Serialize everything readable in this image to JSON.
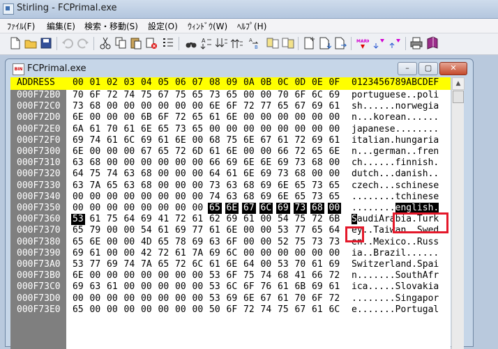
{
  "app": {
    "title": "Stirling - FCPrimal.exe"
  },
  "menu": [
    {
      "label": "ﾌｧｲﾙ(F)"
    },
    {
      "label": "編集(E)"
    },
    {
      "label": "検索・移動(S)"
    },
    {
      "label": "設定(O)"
    },
    {
      "label": "ｳｨﾝﾄﾞｳ(W)"
    },
    {
      "label": "ﾍﾙﾌﾟ(H)"
    }
  ],
  "toolbar": {
    "icons": [
      "new-file-icon",
      "open-folder-icon",
      "save-icon",
      "undo-icon",
      "redo-icon",
      "cut-icon",
      "copy-icon",
      "paste-icon",
      "delete-icon",
      "insert-icon",
      "find-icon",
      "find-next-icon",
      "find-prev-icon",
      "find-all-icon",
      "replace-icon",
      "compare-icon",
      "jump-icon",
      "page-icon",
      "page-down-icon",
      "page-icon-2",
      "mark-icon",
      "mark-next-icon",
      "mark-prev-icon",
      "print-icon",
      "book-icon"
    ]
  },
  "child": {
    "title": "FCPrimal.exe",
    "buttons": {
      "minimize": "–",
      "maximize": "▢",
      "close": "✕"
    }
  },
  "hex": {
    "header": {
      "address": "ADDRESS",
      "cols": [
        "00",
        "01",
        "02",
        "03",
        "04",
        "05",
        "06",
        "07",
        "08",
        "09",
        "0A",
        "0B",
        "0C",
        "0D",
        "0E",
        "0F"
      ],
      "ascii": "0123456789ABCDEF"
    },
    "rows": [
      {
        "addr": "000F72B0",
        "bytes": [
          "70",
          "6F",
          "72",
          "74",
          "75",
          "67",
          "75",
          "65",
          "73",
          "65",
          "00",
          "00",
          "70",
          "6F",
          "6C",
          "69"
        ],
        "ascii": "portuguese..poli"
      },
      {
        "addr": "000F72C0",
        "bytes": [
          "73",
          "68",
          "00",
          "00",
          "00",
          "00",
          "00",
          "00",
          "6E",
          "6F",
          "72",
          "77",
          "65",
          "67",
          "69",
          "61"
        ],
        "ascii": "sh......norwegia"
      },
      {
        "addr": "000F72D0",
        "bytes": [
          "6E",
          "00",
          "00",
          "00",
          "6B",
          "6F",
          "72",
          "65",
          "61",
          "6E",
          "00",
          "00",
          "00",
          "00",
          "00",
          "00"
        ],
        "ascii": "n...korean......"
      },
      {
        "addr": "000F72E0",
        "bytes": [
          "6A",
          "61",
          "70",
          "61",
          "6E",
          "65",
          "73",
          "65",
          "00",
          "00",
          "00",
          "00",
          "00",
          "00",
          "00",
          "00"
        ],
        "ascii": "japanese........"
      },
      {
        "addr": "000F72F0",
        "bytes": [
          "69",
          "74",
          "61",
          "6C",
          "69",
          "61",
          "6E",
          "00",
          "68",
          "75",
          "6E",
          "67",
          "61",
          "72",
          "69",
          "61"
        ],
        "ascii": "italian.hungaria"
      },
      {
        "addr": "000F7300",
        "bytes": [
          "6E",
          "00",
          "00",
          "00",
          "67",
          "65",
          "72",
          "6D",
          "61",
          "6E",
          "00",
          "00",
          "66",
          "72",
          "65",
          "6E"
        ],
        "ascii": "n...german..fren"
      },
      {
        "addr": "000F7310",
        "bytes": [
          "63",
          "68",
          "00",
          "00",
          "00",
          "00",
          "00",
          "00",
          "66",
          "69",
          "6E",
          "6E",
          "69",
          "73",
          "68",
          "00"
        ],
        "ascii": "ch......finnish."
      },
      {
        "addr": "000F7320",
        "bytes": [
          "64",
          "75",
          "74",
          "63",
          "68",
          "00",
          "00",
          "00",
          "64",
          "61",
          "6E",
          "69",
          "73",
          "68",
          "00",
          "00"
        ],
        "ascii": "dutch...danish.."
      },
      {
        "addr": "000F7330",
        "bytes": [
          "63",
          "7A",
          "65",
          "63",
          "68",
          "00",
          "00",
          "00",
          "73",
          "63",
          "68",
          "69",
          "6E",
          "65",
          "73",
          "65"
        ],
        "ascii": "czech...schinese"
      },
      {
        "addr": "000F7340",
        "bytes": [
          "00",
          "00",
          "00",
          "00",
          "00",
          "00",
          "00",
          "00",
          "74",
          "63",
          "68",
          "69",
          "6E",
          "65",
          "73",
          "65"
        ],
        "ascii": "........tchinese"
      },
      {
        "addr": "000F7350",
        "bytes": [
          "00",
          "00",
          "00",
          "00",
          "00",
          "00",
          "00",
          "00",
          "65",
          "6E",
          "67",
          "6C",
          "69",
          "73",
          "68",
          "00"
        ],
        "ascii": "........english."
      },
      {
        "addr": "000F7360",
        "bytes": [
          "53",
          "61",
          "75",
          "64",
          "69",
          "41",
          "72",
          "61",
          "62",
          "69",
          "61",
          "00",
          "54",
          "75",
          "72",
          "6B"
        ],
        "ascii": "SaudiArabia.Turk"
      },
      {
        "addr": "000F7370",
        "bytes": [
          "65",
          "79",
          "00",
          "00",
          "54",
          "61",
          "69",
          "77",
          "61",
          "6E",
          "00",
          "00",
          "53",
          "77",
          "65",
          "64"
        ],
        "ascii": "ey..Taiwan..Swed"
      },
      {
        "addr": "000F7380",
        "bytes": [
          "65",
          "6E",
          "00",
          "00",
          "4D",
          "65",
          "78",
          "69",
          "63",
          "6F",
          "00",
          "00",
          "52",
          "75",
          "73",
          "73"
        ],
        "ascii": "en..Mexico..Russ"
      },
      {
        "addr": "000F7390",
        "bytes": [
          "69",
          "61",
          "00",
          "00",
          "42",
          "72",
          "61",
          "7A",
          "69",
          "6C",
          "00",
          "00",
          "00",
          "00",
          "00",
          "00"
        ],
        "ascii": "ia..Brazil......"
      },
      {
        "addr": "000F73A0",
        "bytes": [
          "53",
          "77",
          "69",
          "74",
          "7A",
          "65",
          "72",
          "6C",
          "61",
          "6E",
          "64",
          "00",
          "53",
          "70",
          "61",
          "69"
        ],
        "ascii": "Switzerland.Spai"
      },
      {
        "addr": "000F73B0",
        "bytes": [
          "6E",
          "00",
          "00",
          "00",
          "00",
          "00",
          "00",
          "00",
          "53",
          "6F",
          "75",
          "74",
          "68",
          "41",
          "66",
          "72"
        ],
        "ascii": "n.......SouthAfr"
      },
      {
        "addr": "000F73C0",
        "bytes": [
          "69",
          "63",
          "61",
          "00",
          "00",
          "00",
          "00",
          "00",
          "53",
          "6C",
          "6F",
          "76",
          "61",
          "6B",
          "69",
          "61"
        ],
        "ascii": "ica.....Slovakia"
      },
      {
        "addr": "000F73D0",
        "bytes": [
          "00",
          "00",
          "00",
          "00",
          "00",
          "00",
          "00",
          "00",
          "53",
          "69",
          "6E",
          "67",
          "61",
          "70",
          "6F",
          "72"
        ],
        "ascii": "........Singapor"
      },
      {
        "addr": "000F73E0",
        "bytes": [
          "65",
          "00",
          "00",
          "00",
          "00",
          "00",
          "00",
          "00",
          "50",
          "6F",
          "72",
          "74",
          "75",
          "67",
          "61",
          "6C"
        ],
        "ascii": "e.......Portugal"
      }
    ]
  }
}
